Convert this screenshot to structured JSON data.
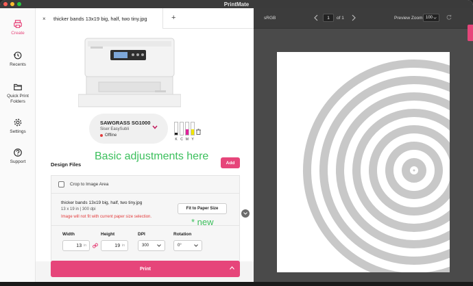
{
  "window": {
    "title": "PrintMate"
  },
  "sidebar": {
    "items": [
      {
        "label": "Create",
        "icon": "printer-icon",
        "active": true
      },
      {
        "label": "Recents",
        "icon": "history-icon",
        "active": false
      },
      {
        "label": "Quick Print Folders",
        "icon": "folder-icon",
        "active": false
      },
      {
        "label": "Settings",
        "icon": "gear-icon",
        "active": false
      },
      {
        "label": "Support",
        "icon": "help-icon",
        "active": false
      }
    ]
  },
  "tabs": {
    "items": [
      {
        "label": "thicker bands 13x19 big, half, two tiny.jpg",
        "close": "×"
      }
    ],
    "add": "+"
  },
  "printer": {
    "name": "SAWGRASS SG1000",
    "subtitle": "Siser EasySubli",
    "status": "Offline",
    "brand": "sawgrass",
    "inks": [
      {
        "label": "K",
        "color": "#222222",
        "level": 0.15
      },
      {
        "label": "C",
        "color": "#2ab7e6",
        "level": 0.0
      },
      {
        "label": "M",
        "color": "#e0239c",
        "level": 0.45
      },
      {
        "label": "Y",
        "color": "#f2e600",
        "level": 0.45
      }
    ]
  },
  "annotations": {
    "basic": "Basic adjustments here",
    "new": "* new"
  },
  "design_files": {
    "title": "Design Files",
    "add_label": "Add",
    "crop_label": "Crop to Image Area",
    "file": {
      "name": "thicker bands 13x19 big, half, two tiny.jpg",
      "dims": "13 x 19 in | 300 dpi",
      "warning": "Image will not fit with current paper size selection."
    },
    "fit_label": "Fit to Paper Size",
    "width_label": "Width",
    "width_value": "13",
    "height_label": "Height",
    "height_value": "19",
    "unit": "in",
    "dpi_label": "DPI",
    "dpi_value": "300",
    "rotation_label": "Rotation",
    "rotation_value": "0°"
  },
  "print": {
    "label": "Print"
  },
  "preview": {
    "color_space": "sRGB",
    "page": "1",
    "of_label": "of",
    "total_pages": "1",
    "zoom_label": "Preview Zoom:",
    "zoom_value": "100",
    "ring_color": "#c8c8c8"
  }
}
